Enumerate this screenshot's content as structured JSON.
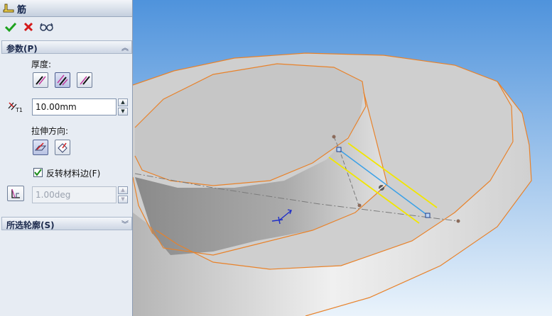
{
  "feature": {
    "title": "筋"
  },
  "actions": {
    "ok_icon": "check-icon",
    "cancel_icon": "close-icon",
    "preview_icon": "glasses-icon"
  },
  "parameters": {
    "header": "参数(P)",
    "thickness_label": "厚度:",
    "thickness_value": "10.00mm",
    "direction_label": "拉伸方向:",
    "reverse_side_label": "反转材料边(F)",
    "reverse_side_checked": true,
    "draft_value": "1.00deg"
  },
  "contours": {
    "header": "所选轮廓(S)"
  },
  "colors": {
    "accent": "#3c55a0",
    "edge": "#e8822a",
    "sketch_yellow": "#f2e600",
    "sketch_blue": "#3aa0e8"
  }
}
